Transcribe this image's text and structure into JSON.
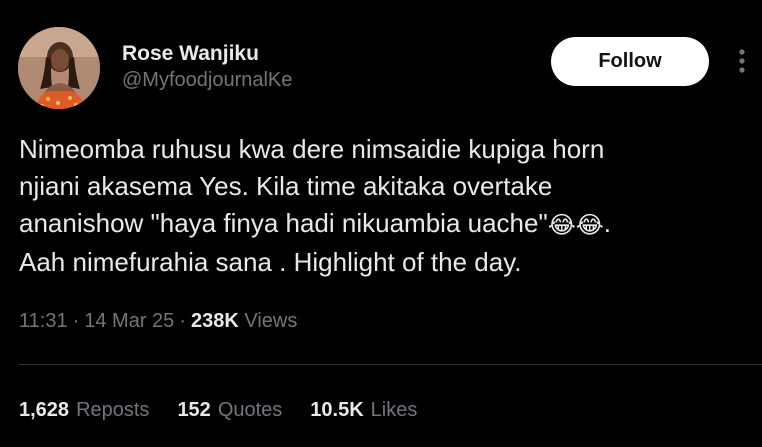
{
  "author": {
    "display_name": "Rose Wanjiku",
    "handle": "@MyfoodjournalKe",
    "avatar_icon": "profile-photo"
  },
  "actions": {
    "follow_label": "Follow",
    "more_icon": "more-vertical-icon"
  },
  "tweet": {
    "lines": [
      "Nimeomba ruhusu kwa dere nimsaidie kupiga horn",
      "njiani akasema Yes. Kila time akitaka overtake",
      "ananishow \"haya finya hadi nikuambia uache\"",
      "Aah nimefurahia sana . Highlight of the day."
    ],
    "emoji": "😂😂",
    "line3_end": "."
  },
  "meta": {
    "time": "11:31",
    "date": "14 Mar 25",
    "separator": "·",
    "views_count": "238K",
    "views_label": "Views"
  },
  "stats": [
    {
      "count": "1,628",
      "label": "Reposts"
    },
    {
      "count": "152",
      "label": "Quotes"
    },
    {
      "count": "10.5K",
      "label": "Likes"
    }
  ],
  "colors": {
    "background": "#000000",
    "text_primary": "#e7e9ea",
    "text_secondary": "#71767b",
    "divider": "#2f3336",
    "follow_bg": "#ffffff",
    "follow_text": "#0f1419"
  }
}
